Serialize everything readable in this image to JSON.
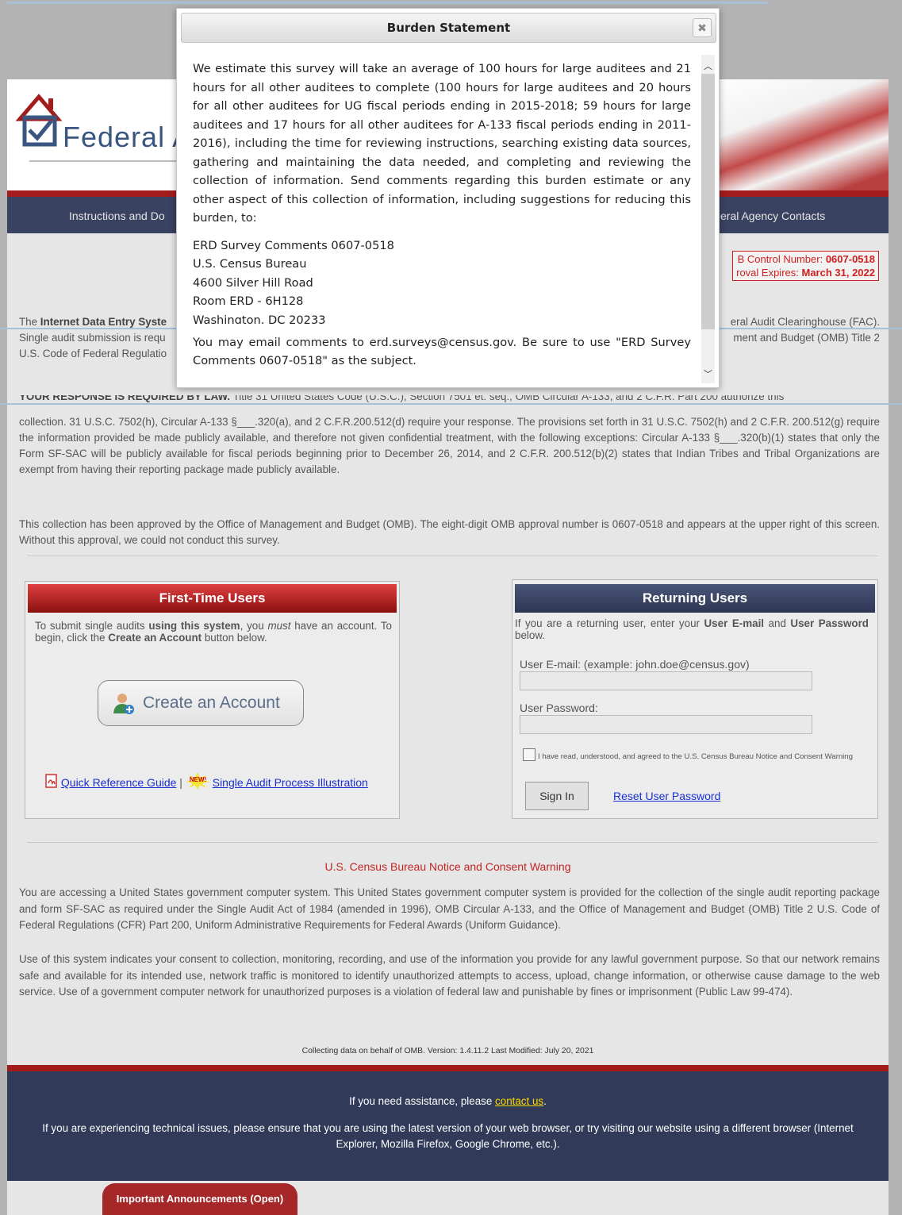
{
  "nav": {
    "left": "Instructions and Do",
    "right": "eral Agency Contacts"
  },
  "logo": {
    "text": "Federal A"
  },
  "omb": {
    "line1_label": "B Control Number: ",
    "line1_value": "0607-0518",
    "line2_label": "roval Expires: ",
    "line2_value": "March 31, 2022"
  },
  "intro": {
    "l1a": "The ",
    "l1b": "Internet Data Entry Syste",
    "l1c": "eral Audit Clearinghouse (FAC).",
    "l2a": "Single audit submission is requ",
    "l2b": "ment and Budget (OMB) Title 2",
    "l3": "U.S. Code of Federal Regulatio"
  },
  "legal": {
    "p1": "collection. 31 U.S.C. 7502(h), Circular A-133 §___.320(a), and 2 C.F.R.200.512(d) require your response. The provisions set forth in 31 U.S.C. 7502(h) and 2 C.F.R. 200.512(g) require the information provided be made publicly available, and therefore not given confidential treatment, with the following exceptions: Circular A-133 §___.320(b)(1) states that only the Form SF-SAC will be publicly available for fiscal periods beginning prior to December 26, 2014, and 2 C.F.R. 200.512(b)(2) states that Indian Tribes and Tribal Organizations are exempt from having their reporting package made publicly available.",
    "p1_hidden_lead": "YOUR RESPONSE IS REQUIRED BY LAW.",
    "p1_hidden_rest": " Title 31 United States Code (U.S.C.), Section 7501 et. seq., OMB Circular A-133, and 2 C.F.R. Part 200 authorize this",
    "p2": "This collection has been approved by the Office of Management and Budget (OMB). The eight-digit OMB approval number is 0607-0518 and appears at the upper right of this screen. Without this approval, we could not conduct this survey."
  },
  "first_time": {
    "title": "First-Time Users",
    "desc_1": "To submit single audits ",
    "desc_2": "using this system",
    "desc_3": ", you ",
    "desc_4": "must",
    "desc_5": " have an account. To begin, click the ",
    "desc_6": "Create an Account",
    "desc_7": " button below.",
    "create_button": "Create an Account",
    "quick_ref": "Quick Reference Guide",
    "separator": " | ",
    "new_badge": "NEW!",
    "illustration": "Single Audit Process Illustration"
  },
  "returning": {
    "title": "Returning Users",
    "desc_1": "If you are a returning user, enter your ",
    "desc_2": "User E-mail",
    "desc_3": " and ",
    "desc_4": "User Password",
    "desc_5": " below.",
    "email_label": "User E-mail: (example: john.doe@census.gov)",
    "email_value": "",
    "password_label": "User Password:",
    "password_value": "",
    "consent_label": "I have read, understood, and agreed to the U.S. Census Bureau Notice and Consent Warning",
    "sign_in": "Sign In",
    "reset": "Reset User Password"
  },
  "notice": {
    "title": "U.S. Census Bureau Notice and Consent Warning",
    "p1": "You are accessing a United States government computer system. This United States government computer system is provided for the collection of the single audit reporting package and form SF-SAC as required under the Single Audit Act of 1984 (amended in 1996), OMB Circular A-133, and the Office of Management and Budget (OMB) Title 2 U.S. Code of Federal Regulations (CFR) Part 200, Uniform Administrative Requirements for Federal Awards (Uniform Guidance).",
    "p2": "Use of this system indicates your consent to collection, monitoring, recording, and use of the information you provide for any lawful government purpose. So that our network remains safe and available for its intended use, network traffic is monitored to identify unauthorized attempts to access, upload, change information, or otherwise cause damage to the web service. Use of a government computer network for unauthorized purposes is a violation of federal law and punishable by fines or imprisonment (Public Law 99-474).",
    "version": "Collecting data on behalf of OMB. Version: 1.4.11.2   Last Modified: July 20, 2021"
  },
  "footer": {
    "assist_1": "If you need assistance, please ",
    "assist_link": "contact us",
    "assist_2": ".",
    "tech": "If you are experiencing technical issues, please ensure that you are using the latest version of your web browser, or try visiting our website using a different browser (Internet Explorer, Mozilla Firefox, Google Chrome, etc.)."
  },
  "announcements": "Important Announcements (Open)",
  "dialog": {
    "title": "Burden Statement",
    "close": "✖",
    "body": "We estimate this survey will take an average of 100 hours for large auditees and 21 hours for all other auditees to complete (100 hours for large auditees and 20 hours for all other auditees for UG fiscal periods ending in 2015-2018; 59 hours for large auditees and 17 hours for all other auditees for A-133 fiscal periods ending in 2011-2016), including the time for reviewing instructions, searching existing data sources, gathering and maintaining the data needed, and completing and reviewing the collection of information. Send comments regarding this burden estimate or any other aspect of this collection of information, including suggestions for reducing this burden, to:",
    "addr1": "ERD Survey Comments 0607-0518",
    "addr2": "U.S. Census Bureau",
    "addr3": "4600 Silver Hill Road",
    "addr4": "Room ERD - 6H128",
    "addr5": "Washington, DC 20233",
    "email_note": "You may email comments to erd.surveys@census.gov. Be sure to use \"ERD Survey Comments 0607-0518\" as the subject."
  },
  "colors": {
    "navy": "#394261",
    "red": "#a21c1c",
    "link": "#1a2fd0"
  }
}
